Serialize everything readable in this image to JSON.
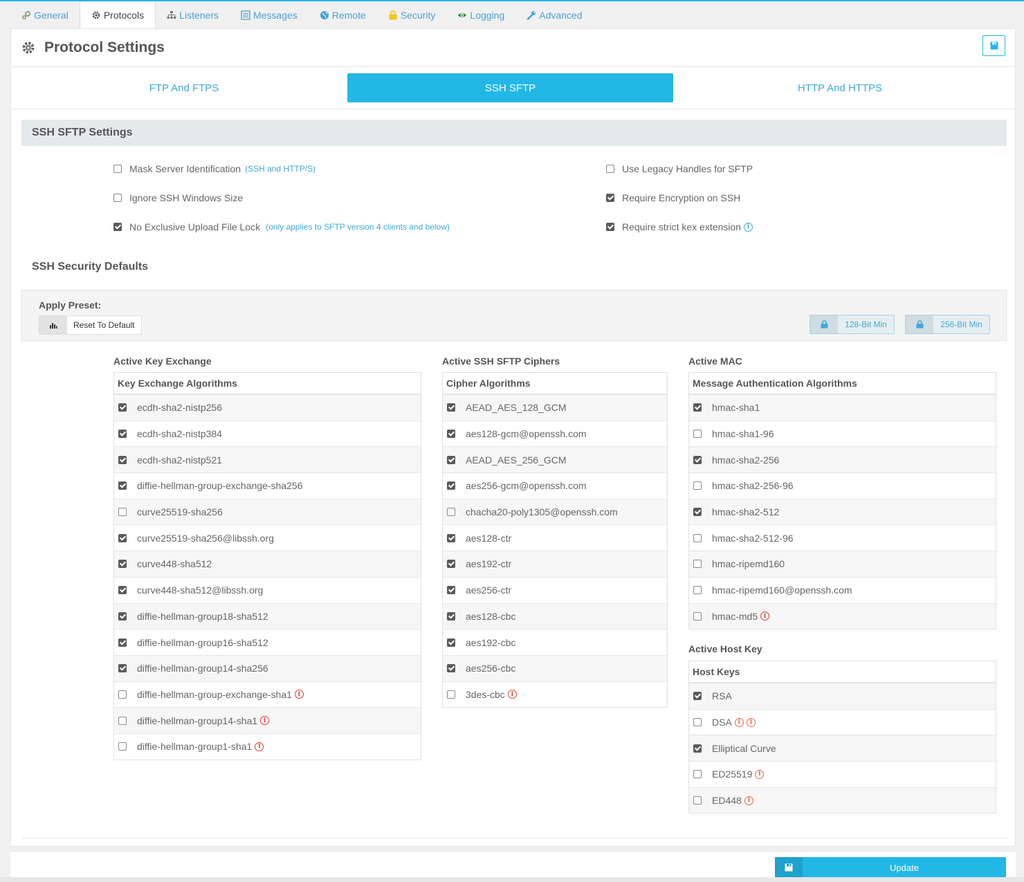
{
  "topnav": [
    {
      "label": "General",
      "icon": "cogs-icon",
      "active": false
    },
    {
      "label": "Protocols",
      "icon": "gear-icon",
      "active": true
    },
    {
      "label": "Listeners",
      "icon": "sitemap-icon",
      "active": false
    },
    {
      "label": "Messages",
      "icon": "list-icon",
      "active": false
    },
    {
      "label": "Remote",
      "icon": "globe-icon",
      "active": false
    },
    {
      "label": "Security",
      "icon": "lock-icon",
      "active": false
    },
    {
      "label": "Logging",
      "icon": "eye-icon",
      "active": false
    },
    {
      "label": "Advanced",
      "icon": "wrench-icon",
      "active": false
    }
  ],
  "header": {
    "title": "Protocol Settings"
  },
  "subtabs": [
    "FTP And FTPS",
    "SSH SFTP",
    "HTTP And HTTPS"
  ],
  "section_title": "SSH SFTP Settings",
  "options": {
    "mask_server": {
      "label": "Mask Server Identification",
      "note": "(SSH and HTTP/S)",
      "checked": false
    },
    "ignore_window": {
      "label": "Ignore SSH Windows Size",
      "checked": false
    },
    "no_exclusive": {
      "label": "No Exclusive Upload File Lock",
      "note": "(only applies to SFTP version 4 clients and below)",
      "checked": true
    },
    "legacy_handles": {
      "label": "Use Legacy Handles for SFTP",
      "checked": false
    },
    "require_encryption": {
      "label": "Require Encryption on SSH",
      "checked": true
    },
    "strict_kex": {
      "label": "Require strict kex extension",
      "checked": true
    }
  },
  "security_defaults_title": "SSH Security Defaults",
  "preset": {
    "label": "Apply Preset:",
    "reset": "Reset To Default",
    "min128": "128-Bit Min",
    "min256": "256-Bit Min"
  },
  "kex": {
    "title": "Active Key Exchange",
    "header": "Key Exchange Algorithms",
    "rows": [
      {
        "label": "ecdh-sha2-nistp256",
        "checked": true,
        "warn": 0
      },
      {
        "label": "ecdh-sha2-nistp384",
        "checked": true,
        "warn": 0
      },
      {
        "label": "ecdh-sha2-nistp521",
        "checked": true,
        "warn": 0
      },
      {
        "label": "diffie-hellman-group-exchange-sha256",
        "checked": true,
        "warn": 0
      },
      {
        "label": "curve25519-sha256",
        "checked": false,
        "warn": 0
      },
      {
        "label": "curve25519-sha256@libssh.org",
        "checked": true,
        "warn": 0
      },
      {
        "label": "curve448-sha512",
        "checked": true,
        "warn": 0
      },
      {
        "label": "curve448-sha512@libssh.org",
        "checked": true,
        "warn": 0
      },
      {
        "label": "diffie-hellman-group18-sha512",
        "checked": true,
        "warn": 0
      },
      {
        "label": "diffie-hellman-group16-sha512",
        "checked": true,
        "warn": 0
      },
      {
        "label": "diffie-hellman-group14-sha256",
        "checked": true,
        "warn": 0
      },
      {
        "label": "diffie-hellman-group-exchange-sha1",
        "checked": false,
        "warn": 1
      },
      {
        "label": "diffie-hellman-group14-sha1",
        "checked": false,
        "warn": 1
      },
      {
        "label": "diffie-hellman-group1-sha1",
        "checked": false,
        "warn": 1
      }
    ]
  },
  "ciphers": {
    "title": "Active SSH SFTP Ciphers",
    "header": "Cipher Algorithms",
    "rows": [
      {
        "label": "AEAD_AES_128_GCM",
        "checked": true,
        "warn": 0
      },
      {
        "label": "aes128-gcm@openssh.com",
        "checked": true,
        "warn": 0
      },
      {
        "label": "AEAD_AES_256_GCM",
        "checked": true,
        "warn": 0
      },
      {
        "label": "aes256-gcm@openssh.com",
        "checked": true,
        "warn": 0
      },
      {
        "label": "chacha20-poly1305@openssh.com",
        "checked": false,
        "warn": 0
      },
      {
        "label": "aes128-ctr",
        "checked": true,
        "warn": 0
      },
      {
        "label": "aes192-ctr",
        "checked": true,
        "warn": 0
      },
      {
        "label": "aes256-ctr",
        "checked": true,
        "warn": 0
      },
      {
        "label": "aes128-cbc",
        "checked": true,
        "warn": 0
      },
      {
        "label": "aes192-cbc",
        "checked": true,
        "warn": 0
      },
      {
        "label": "aes256-cbc",
        "checked": true,
        "warn": 0
      },
      {
        "label": "3des-cbc",
        "checked": false,
        "warn": 1
      }
    ]
  },
  "mac": {
    "title": "Active MAC",
    "header": "Message Authentication Algorithms",
    "rows": [
      {
        "label": "hmac-sha1",
        "checked": true,
        "warn": 0
      },
      {
        "label": "hmac-sha1-96",
        "checked": false,
        "warn": 0
      },
      {
        "label": "hmac-sha2-256",
        "checked": true,
        "warn": 0
      },
      {
        "label": "hmac-sha2-256-96",
        "checked": false,
        "warn": 0
      },
      {
        "label": "hmac-sha2-512",
        "checked": true,
        "warn": 0
      },
      {
        "label": "hmac-sha2-512-96",
        "checked": false,
        "warn": 0
      },
      {
        "label": "hmac-ripemd160",
        "checked": false,
        "warn": 0
      },
      {
        "label": "hmac-ripemd160@openssh.com",
        "checked": false,
        "warn": 0
      },
      {
        "label": "hmac-md5",
        "checked": false,
        "warn": 1
      }
    ]
  },
  "hostkey": {
    "title": "Active Host Key",
    "header": "Host Keys",
    "rows": [
      {
        "label": "RSA",
        "checked": true,
        "warn": 0
      },
      {
        "label": "DSA",
        "checked": false,
        "warn": 2
      },
      {
        "label": "Elliptical Curve",
        "checked": true,
        "warn": 0
      },
      {
        "label": "ED25519",
        "checked": false,
        "warn": 1
      },
      {
        "label": "ED448",
        "checked": false,
        "warn": 1
      }
    ]
  },
  "footer": {
    "update": "Update"
  },
  "colors": {
    "accent": "#23b7e5",
    "link": "#3fa9d6",
    "warn": "#e03c31"
  }
}
